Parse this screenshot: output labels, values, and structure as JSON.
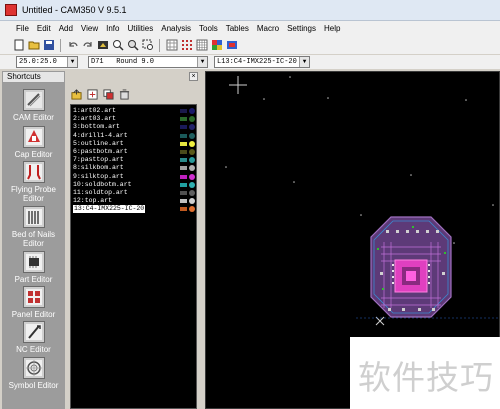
{
  "window": {
    "title": "Untitled - CAM350 V 9.5.1"
  },
  "menu": [
    "File",
    "Edit",
    "Add",
    "View",
    "Info",
    "Utilities",
    "Analysis",
    "Tools",
    "Tables",
    "Macro",
    "Settings",
    "Help"
  ],
  "toolbar": {
    "buttons": [
      "new-icon",
      "open-icon",
      "save-icon",
      "undo-icon",
      "redo-icon",
      "redraw-icon",
      "zoom-in-icon",
      "zoom-out-icon",
      "zoom-window-icon",
      "grid-icon",
      "snap-icon",
      "layers-icon",
      "color-icon"
    ]
  },
  "combos": {
    "grid": "25.0:25.0",
    "dcode": "D71   Round 9.0",
    "layer": "L13:C4-IMX225-IC-20"
  },
  "shortcuts": {
    "header": "Shortcuts",
    "items": [
      {
        "label": "CAM Editor",
        "icon": "cam-editor-icon"
      },
      {
        "label": "Cap Editor",
        "icon": "cap-editor-icon"
      },
      {
        "label": "Flying Probe Editor",
        "icon": "flying-probe-icon"
      },
      {
        "label": "Bed of Nails Editor",
        "icon": "bed-of-nails-icon"
      },
      {
        "label": "Part Editor",
        "icon": "part-editor-icon"
      },
      {
        "label": "Panel Editor",
        "icon": "panel-editor-icon"
      },
      {
        "label": "NC Editor",
        "icon": "nc-editor-icon"
      },
      {
        "label": "Symbol Editor",
        "icon": "symbol-editor-icon"
      }
    ]
  },
  "layers": [
    {
      "name": "1:art02.art",
      "swatch": "#1a1a4a",
      "dot": "#1a1a6a"
    },
    {
      "name": "2:art03.art",
      "swatch": "#2a6a2a",
      "dot": "#2a6a2a"
    },
    {
      "name": "3:bottom.art",
      "swatch": "#1a1a5a",
      "dot": "#22226a"
    },
    {
      "name": "4:drill1-4.art",
      "swatch": "#1a5a5a",
      "dot": "#206060"
    },
    {
      "name": "5:outline.art",
      "swatch": "#e6e640",
      "dot": "#f0f040"
    },
    {
      "name": "6:pastbotm.art",
      "swatch": "#4a4a1a",
      "dot": "#5a5a1a"
    },
    {
      "name": "7:pasttop.art",
      "swatch": "#2a8a8a",
      "dot": "#2a9a9a"
    },
    {
      "name": "8:silkbom.art",
      "swatch": "#a0a0a0",
      "dot": "#b0b0b0"
    },
    {
      "name": "9:silktop.art",
      "swatch": "#c020c0",
      "dot": "#d030d0"
    },
    {
      "name": "10:soldbotm.art",
      "swatch": "#20a0a0",
      "dot": "#30b0b0"
    },
    {
      "name": "11:soldtop.art",
      "swatch": "#505050",
      "dot": "#606060"
    },
    {
      "name": "12:top.art",
      "swatch": "#c0c0c0",
      "dot": "#d0d0d0"
    },
    {
      "name": "13:C4-IMX225-IC-20",
      "swatch": "#c05a20",
      "dot": "#e07030"
    }
  ],
  "active_layer_index": 12,
  "watermark": {
    "text": "软件技巧"
  }
}
